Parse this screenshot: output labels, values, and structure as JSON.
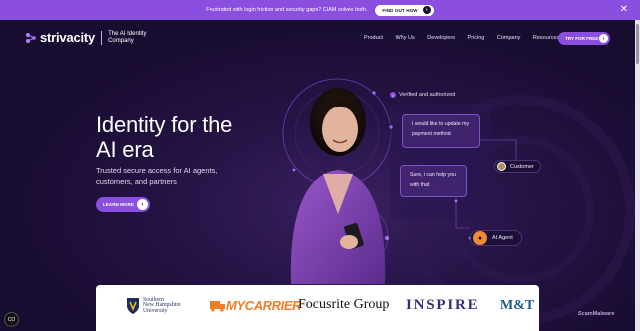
{
  "banner": {
    "text": "Frustrated with login friction and security gaps? CIAM solves both.",
    "button_label": "FIND OUT HOW",
    "close_label": "✕"
  },
  "header": {
    "brand": "strivacity",
    "tagline": "The AI Identity Company",
    "nav": [
      "Product",
      "Why Us",
      "Developers",
      "Pricing",
      "Company",
      "Resources"
    ],
    "cta_label": "TRY FOR FREE"
  },
  "hero": {
    "headline_line1": "Identity for the",
    "headline_line2": "AI era",
    "subhead": "Trusted secure access for AI agents, customers, and partners",
    "learn_label": "LEARN MORE"
  },
  "illustration": {
    "verified": "Verified and authorized",
    "bubble_customer": "I would like to update my payment method",
    "bubble_agent": "Sure, i can help you with that",
    "customer_tag": "Customer",
    "agent_tag": "AI Agent"
  },
  "logos": {
    "snh": "Southern New Hampshire University",
    "snh_line1": "Southern",
    "snh_line2": "New Hampshire",
    "snh_line3": "University",
    "mycarrier": "MYCARRIER",
    "focusrite": "Focusrite Group",
    "inspire": "INSPIRE",
    "mt": "M&T"
  },
  "widgets": {
    "cookie_label": "CO",
    "scan_label": "ScamMalware"
  },
  "colors": {
    "accent": "#8b4fe0",
    "background": "#1c0e35"
  }
}
